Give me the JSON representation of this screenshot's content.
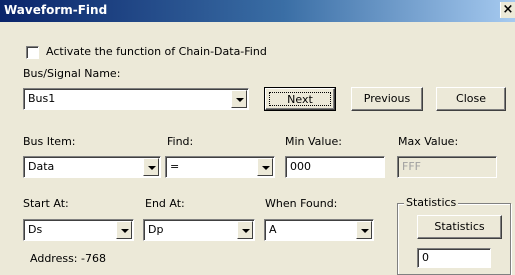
{
  "window": {
    "title": "Waveform-Find",
    "close_glyph": "×"
  },
  "activate": {
    "label": "Activate the function of Chain-Data-Find",
    "checked": false
  },
  "bus_signal": {
    "label": "Bus/Signal Name:",
    "value": "Bus1"
  },
  "buttons": {
    "next": "Next",
    "previous": "Previous",
    "close": "Close"
  },
  "bus_item": {
    "label": "Bus Item:",
    "value": "Data"
  },
  "find": {
    "label": "Find:",
    "value": "="
  },
  "min_value": {
    "label": "Min Value:",
    "value": "000"
  },
  "max_value": {
    "label": "Max Value:",
    "value": "FFF"
  },
  "start_at": {
    "label": "Start At:",
    "value": "Ds"
  },
  "end_at": {
    "label": "End At:",
    "value": "Dp"
  },
  "when_found": {
    "label": "When Found:",
    "value": "A"
  },
  "statistics": {
    "group_label": "Statistics",
    "button_label": "Statistics",
    "count": "0"
  },
  "address": {
    "text": "Address: -768"
  }
}
